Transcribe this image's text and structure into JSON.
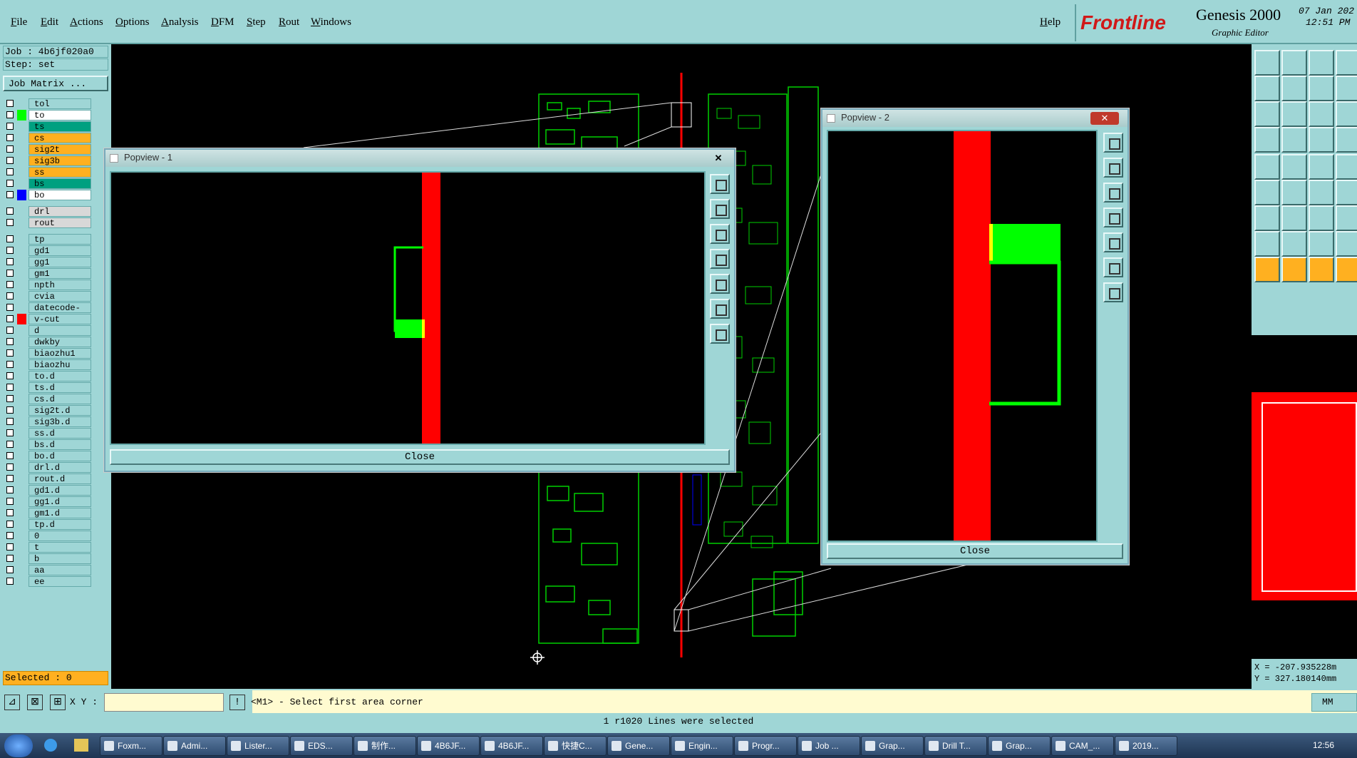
{
  "menubar": {
    "items": [
      "File",
      "Edit",
      "Actions",
      "Options",
      "Analysis",
      "DFM",
      "Step",
      "Rout",
      "Windows"
    ],
    "help": "Help"
  },
  "brand": {
    "logo": "Frontline",
    "product": "Genesis 2000",
    "subtitle": "Graphic Editor",
    "date": "07 Jan 202",
    "time": "12:51 PM"
  },
  "left_panel": {
    "job": "Job : 4b6jf020a0",
    "step": "Step: set",
    "matrix_button": "Job Matrix ...",
    "layers": [
      {
        "name": "tol",
        "color": "#9fd6d6",
        "bg": "#9fd6d6"
      },
      {
        "name": "to",
        "color": "#00ff00",
        "bg": "#ffffff"
      },
      {
        "name": "ts",
        "color": "#9fd6d6",
        "bg": "#00a080"
      },
      {
        "name": "cs",
        "color": "#9fd6d6",
        "bg": "#ffb020"
      },
      {
        "name": "sig2t",
        "color": "#9fd6d6",
        "bg": "#ffb020"
      },
      {
        "name": "sig3b",
        "color": "#9fd6d6",
        "bg": "#ffb020"
      },
      {
        "name": "ss",
        "color": "#9fd6d6",
        "bg": "#ffb020"
      },
      {
        "name": "bs",
        "color": "#9fd6d6",
        "bg": "#00a080"
      },
      {
        "name": "bo",
        "color": "#0000ff",
        "bg": "#ffffff"
      },
      {
        "name": "drl",
        "color": "#9fd6d6",
        "bg": "#d8d8d8"
      },
      {
        "name": "rout",
        "color": "#9fd6d6",
        "bg": "#d8d8d8"
      },
      {
        "name": "tp",
        "color": "#9fd6d6",
        "bg": "#9fd6d6"
      },
      {
        "name": "gd1",
        "color": "#9fd6d6",
        "bg": "#9fd6d6"
      },
      {
        "name": "gg1",
        "color": "#9fd6d6",
        "bg": "#9fd6d6"
      },
      {
        "name": "gm1",
        "color": "#9fd6d6",
        "bg": "#9fd6d6"
      },
      {
        "name": "npth",
        "color": "#9fd6d6",
        "bg": "#9fd6d6"
      },
      {
        "name": "cvia",
        "color": "#9fd6d6",
        "bg": "#9fd6d6"
      },
      {
        "name": "datecode-ptc",
        "color": "#9fd6d6",
        "bg": "#9fd6d6"
      },
      {
        "name": "v-cut",
        "color": "#ff0000",
        "bg": "#9fd6d6"
      },
      {
        "name": "d",
        "color": "#9fd6d6",
        "bg": "#9fd6d6"
      },
      {
        "name": "dwkby",
        "color": "#9fd6d6",
        "bg": "#9fd6d6"
      },
      {
        "name": "biaozhu1",
        "color": "#9fd6d6",
        "bg": "#9fd6d6"
      },
      {
        "name": "biaozhu",
        "color": "#9fd6d6",
        "bg": "#9fd6d6"
      },
      {
        "name": "to.d",
        "color": "#9fd6d6",
        "bg": "#9fd6d6"
      },
      {
        "name": "ts.d",
        "color": "#9fd6d6",
        "bg": "#9fd6d6"
      },
      {
        "name": "cs.d",
        "color": "#9fd6d6",
        "bg": "#9fd6d6"
      },
      {
        "name": "sig2t.d",
        "color": "#9fd6d6",
        "bg": "#9fd6d6"
      },
      {
        "name": "sig3b.d",
        "color": "#9fd6d6",
        "bg": "#9fd6d6"
      },
      {
        "name": "ss.d",
        "color": "#9fd6d6",
        "bg": "#9fd6d6"
      },
      {
        "name": "bs.d",
        "color": "#9fd6d6",
        "bg": "#9fd6d6"
      },
      {
        "name": "bo.d",
        "color": "#9fd6d6",
        "bg": "#9fd6d6"
      },
      {
        "name": "drl.d",
        "color": "#9fd6d6",
        "bg": "#9fd6d6"
      },
      {
        "name": "rout.d",
        "color": "#9fd6d6",
        "bg": "#9fd6d6"
      },
      {
        "name": "gd1.d",
        "color": "#9fd6d6",
        "bg": "#9fd6d6"
      },
      {
        "name": "gg1.d",
        "color": "#9fd6d6",
        "bg": "#9fd6d6"
      },
      {
        "name": "gm1.d",
        "color": "#9fd6d6",
        "bg": "#9fd6d6"
      },
      {
        "name": "tp.d",
        "color": "#9fd6d6",
        "bg": "#9fd6d6"
      },
      {
        "name": "0",
        "color": "#9fd6d6",
        "bg": "#9fd6d6"
      },
      {
        "name": "t",
        "color": "#9fd6d6",
        "bg": "#9fd6d6"
      },
      {
        "name": "b",
        "color": "#9fd6d6",
        "bg": "#9fd6d6"
      },
      {
        "name": "aa",
        "color": "#9fd6d6",
        "bg": "#9fd6d6"
      },
      {
        "name": "ee",
        "color": "#9fd6d6",
        "bg": "#9fd6d6"
      }
    ],
    "selected": "Selected : 0"
  },
  "popview1": {
    "title": "Popview - 1",
    "close": "Close"
  },
  "popview2": {
    "title": "Popview - 2",
    "close": "Close"
  },
  "coords": {
    "x": "X = -207.935228m",
    "y": "Y = 327.180140mm"
  },
  "command": {
    "xy_label": "X Y :",
    "prompt": "<M1> - Select first area corner",
    "units": "MM"
  },
  "status": "1 r1020 Lines were selected",
  "taskbar": {
    "items": [
      "Foxm...",
      "Admi...",
      "Lister...",
      "EDS...",
      "制作...",
      "4B6JF...",
      "4B6JF...",
      "快捷C...",
      "Gene...",
      "Engin...",
      "Progr...",
      "Job ...",
      "Grap...",
      "Drill T...",
      "Grap...",
      "CAM_...",
      "2019..."
    ],
    "clock": "12:56"
  },
  "colors": {
    "panel": "#9fd6d6",
    "red_feature": "#ff0000",
    "green_feature": "#00ff00"
  }
}
